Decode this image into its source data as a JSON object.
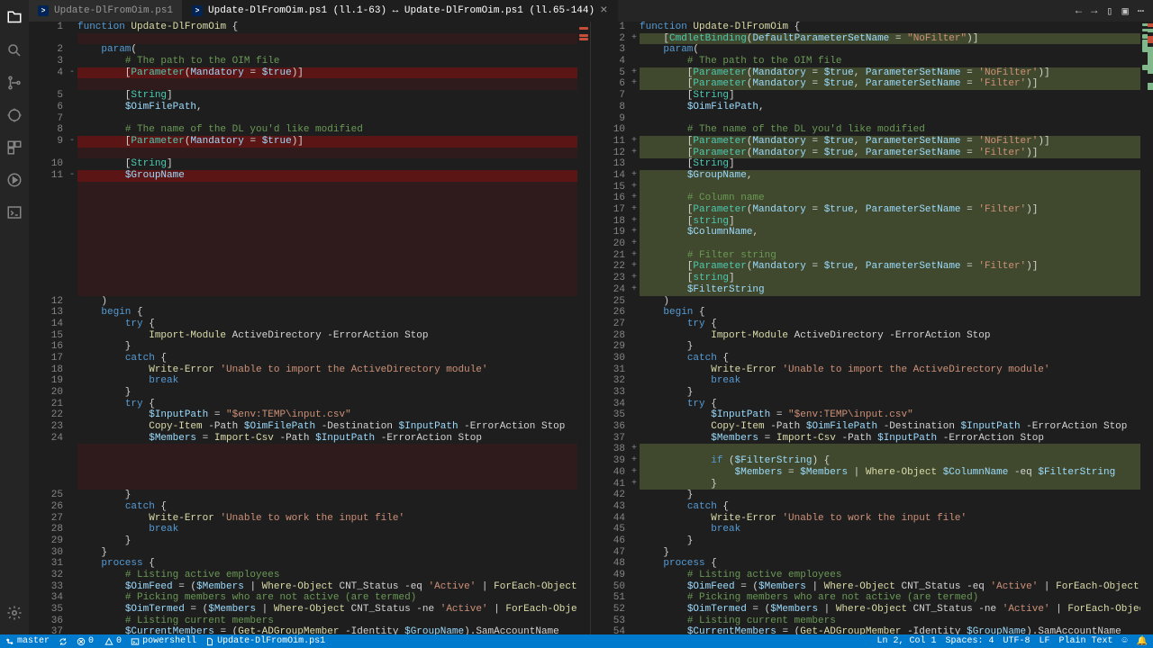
{
  "tabs": [
    {
      "label": "Update-DlFromOim.ps1"
    },
    {
      "label": "Update-DlFromOim.ps1 (ll.1-63) ↔ Update-DlFromOim.ps1 (ll.65-144)"
    }
  ],
  "status": {
    "branch": "master",
    "sync": "",
    "err": "0",
    "warn": "0",
    "shell": "powershell",
    "file": "Update-DlFromOim.ps1",
    "pos": "Ln 2, Col 1",
    "spaces": "Spaces: 4",
    "enc": "UTF-8",
    "eol": "LF",
    "lang": "Plain Text"
  },
  "icons": {
    "back": "←",
    "fwd": "→",
    "layout": "▯",
    "split": "▣",
    "more": "⋯"
  }
}
